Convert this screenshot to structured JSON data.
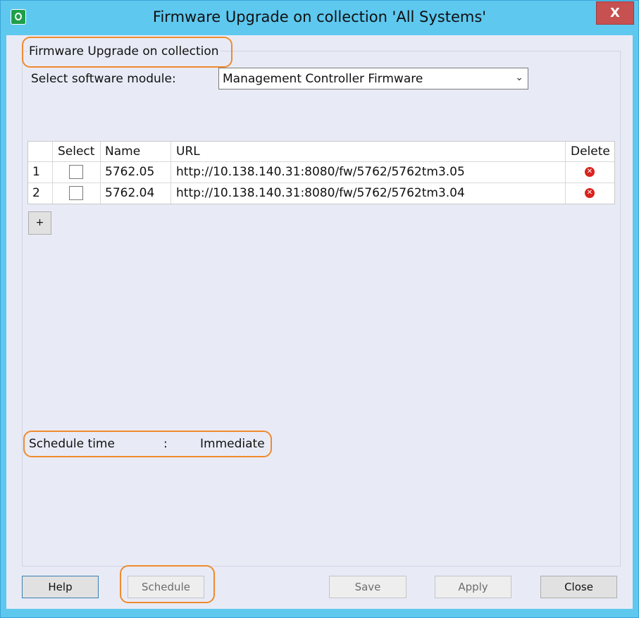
{
  "window": {
    "title": "Firmware Upgrade on collection 'All Systems'",
    "close_label": "X"
  },
  "group": {
    "title": "Firmware Upgrade on collection"
  },
  "module": {
    "label": "Select software module:",
    "selected": "Management Controller Firmware"
  },
  "table": {
    "headers": [
      "",
      "Select",
      "Name",
      "URL",
      "Delete"
    ],
    "rows": [
      {
        "index": "1",
        "selected": false,
        "name": "5762.05",
        "url": "http://10.138.140.31:8080/fw/5762/5762tm3.05"
      },
      {
        "index": "2",
        "selected": false,
        "name": "5762.04",
        "url": "http://10.138.140.31:8080/fw/5762/5762tm3.04"
      }
    ]
  },
  "add_button": "+",
  "schedule": {
    "label": "Schedule time",
    "separator": ":",
    "value": "Immediate"
  },
  "buttons": {
    "help": "Help",
    "schedule": "Schedule",
    "save": "Save",
    "apply": "Apply",
    "close": "Close"
  },
  "colors": {
    "titlebar": "#5ec8ef",
    "client": "#e8ebf6",
    "highlight": "#f08a2c",
    "close_button": "#c75050",
    "delete_icon": "#d9231e"
  },
  "icons": {
    "app": "app-power-icon",
    "close": "close-icon",
    "dropdown": "chevron-down-icon",
    "delete": "delete-x-icon",
    "add": "plus-icon"
  }
}
